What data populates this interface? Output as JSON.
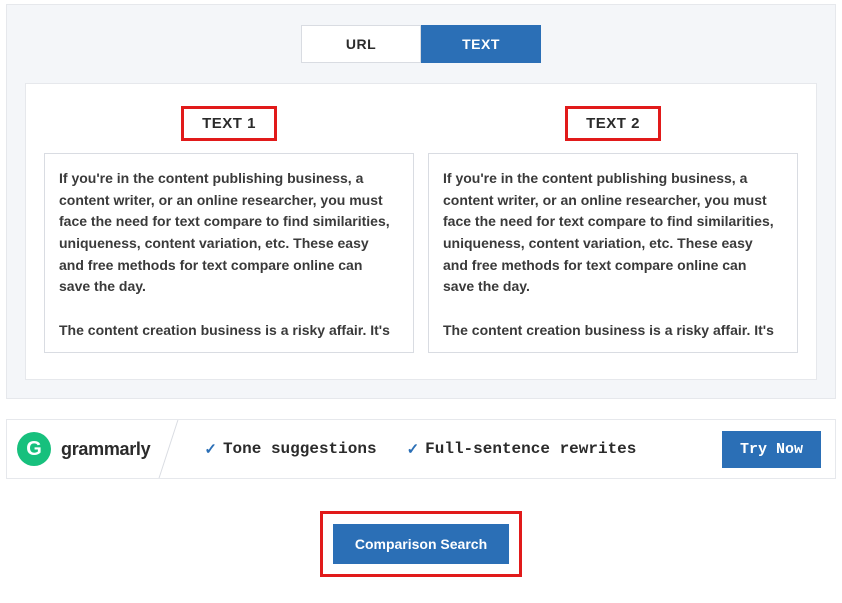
{
  "tabs": {
    "url": "URL",
    "text": "TEXT"
  },
  "columns": {
    "left": {
      "header": "TEXT 1",
      "content": "If you're in the content publishing business, a content writer, or an online researcher, you must face the need for text compare to find similarities, uniqueness, content variation, etc. These easy and free methods for text compare online can save the day.\n\nThe content creation business is a risky affair. It's "
    },
    "right": {
      "header": "TEXT 2",
      "content": "If you're in the content publishing business, a content writer, or an online researcher, you must face the need for text compare to find similarities, uniqueness, content variation, etc. These easy and free methods for text compare online can save the day.\n\nThe content creation business is a risky affair. It's "
    }
  },
  "ad": {
    "brand_initial": "G",
    "brand_name": "grammarly",
    "feature1": "Tone suggestions",
    "feature2": "Full-sentence rewrites",
    "cta": "Try Now"
  },
  "search_button": "Comparison Search"
}
